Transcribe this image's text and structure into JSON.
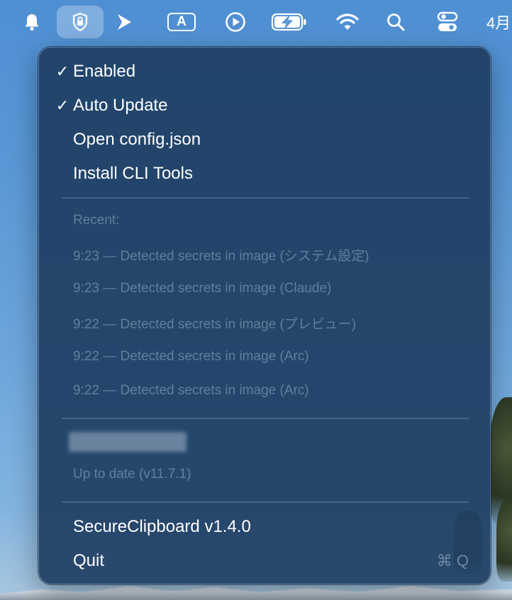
{
  "menubar": {
    "clock_text": "4月",
    "icons": [
      "bell-icon",
      "shield-lock-icon",
      "chevron-right-icon",
      "input-source-icon",
      "play-circle-icon",
      "battery-charging-icon",
      "wifi-icon",
      "search-icon",
      "control-center-icon"
    ],
    "input_source_letter": "A"
  },
  "menu": {
    "items": {
      "enabled": {
        "check": "✓",
        "label": "Enabled"
      },
      "auto_update": {
        "check": "✓",
        "label": "Auto Update"
      },
      "open_config": {
        "label": "Open config.json"
      },
      "install_cli": {
        "label": "Install CLI Tools"
      }
    },
    "recent": {
      "header": "Recent:",
      "entries": [
        "9:23 — Detected secrets in image (システム設定)",
        "9:23 — Detected secrets in image (Claude)",
        "9:22 — Detected secrets in image (プレビュー)",
        "9:22 — Detected secrets in image (Arc)",
        "9:22 — Detected secrets in image (Arc)"
      ]
    },
    "update_status": "Up to date (v11.7.1)",
    "app_version": "SecureClipboard v1.4.0",
    "quit": {
      "label": "Quit",
      "shortcut": "⌘ Q"
    }
  },
  "colors": {
    "menu_background": "#1e3e62",
    "desktop_sky": "#5b98d6",
    "text": "#ffffff"
  }
}
